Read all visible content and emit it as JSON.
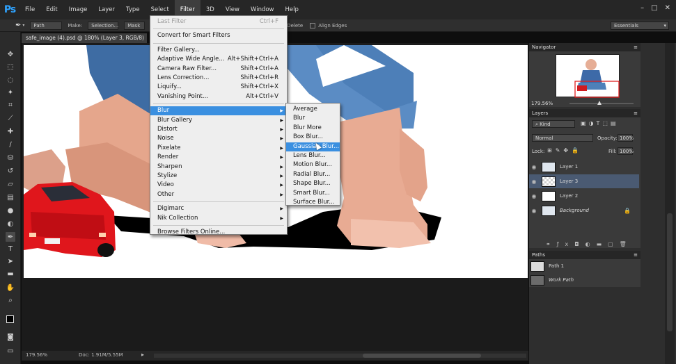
{
  "app": {
    "logo": "Ps"
  },
  "menubar": {
    "items": [
      "File",
      "Edit",
      "Image",
      "Layer",
      "Type",
      "Select",
      "Filter",
      "3D",
      "View",
      "Window",
      "Help"
    ],
    "active": "Filter",
    "window_controls": [
      "–",
      "□",
      "✕"
    ]
  },
  "options": {
    "mode": "Path",
    "make_label": "Make:",
    "selection_btn": "Selection...",
    "mask_btn": "Mask",
    "delete_label": "Delete",
    "align_edges_label": "Align Edges",
    "workspace": "Essentials"
  },
  "document": {
    "tab_title": "safe_image (4).psd @ 180% (Layer 3, RGB/8) *",
    "zoom": "179.56%",
    "doc_info": "Doc: 1.91M/5.55M"
  },
  "filter_menu": {
    "items": [
      {
        "label": "Last Filter",
        "shortcut": "Ctrl+F",
        "disabled": true
      },
      {
        "sep": true
      },
      {
        "label": "Convert for Smart Filters"
      },
      {
        "sep": true
      },
      {
        "label": "Filter Gallery..."
      },
      {
        "label": "Adaptive Wide Angle...",
        "shortcut": "Alt+Shift+Ctrl+A"
      },
      {
        "label": "Camera Raw Filter...",
        "shortcut": "Shift+Ctrl+A"
      },
      {
        "label": "Lens Correction...",
        "shortcut": "Shift+Ctrl+R"
      },
      {
        "label": "Liquify...",
        "shortcut": "Shift+Ctrl+X"
      },
      {
        "label": "Vanishing Point...",
        "shortcut": "Alt+Ctrl+V"
      },
      {
        "sep": true
      },
      {
        "label": "Blur",
        "submenu": true,
        "highlighted": true
      },
      {
        "label": "Blur Gallery",
        "submenu": true
      },
      {
        "label": "Distort",
        "submenu": true
      },
      {
        "label": "Noise",
        "submenu": true
      },
      {
        "label": "Pixelate",
        "submenu": true
      },
      {
        "label": "Render",
        "submenu": true
      },
      {
        "label": "Sharpen",
        "submenu": true
      },
      {
        "label": "Stylize",
        "submenu": true
      },
      {
        "label": "Video",
        "submenu": true
      },
      {
        "label": "Other",
        "submenu": true
      },
      {
        "sep": true
      },
      {
        "label": "Digimarc",
        "submenu": true
      },
      {
        "label": "Nik Collection",
        "submenu": true
      },
      {
        "sep": true
      },
      {
        "label": "Browse Filters Online..."
      }
    ]
  },
  "blur_submenu": {
    "items": [
      {
        "label": "Average"
      },
      {
        "label": "Blur"
      },
      {
        "label": "Blur More"
      },
      {
        "label": "Box Blur..."
      },
      {
        "label": "Gaussian Blur...",
        "highlighted": true
      },
      {
        "label": "Lens Blur..."
      },
      {
        "label": "Motion Blur..."
      },
      {
        "label": "Radial Blur..."
      },
      {
        "label": "Shape Blur..."
      },
      {
        "label": "Smart Blur..."
      },
      {
        "label": "Surface Blur..."
      }
    ]
  },
  "navigator": {
    "title": "Navigator",
    "zoom": "179.56%"
  },
  "layers_panel": {
    "title": "Layers",
    "kind_label": "Kind",
    "blend_mode": "Normal",
    "opacity_label": "Opacity:",
    "opacity_value": "100%",
    "lock_label": "Lock:",
    "fill_label": "Fill:",
    "fill_value": "100%",
    "layers": [
      {
        "name": "Layer 1",
        "thumb": "child"
      },
      {
        "name": "Layer 3",
        "thumb": "checker",
        "selected": true
      },
      {
        "name": "Layer 2",
        "thumb": "white"
      },
      {
        "name": "Background",
        "thumb": "child",
        "italic": true,
        "locked": true
      }
    ]
  },
  "paths_panel": {
    "title": "Paths",
    "paths": [
      {
        "name": "Path 1",
        "thumb": "child"
      },
      {
        "name": "Work Path",
        "thumb": "dark",
        "italic": true
      }
    ]
  }
}
